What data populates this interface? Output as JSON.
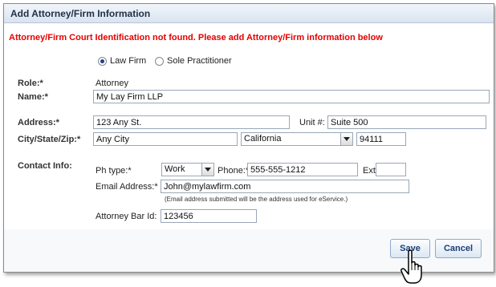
{
  "dialog": {
    "title": "Add Attorney/Firm Information"
  },
  "error_message": "Attorney/Firm Court Identification not found. Please add Attorney/Firm information below",
  "firm_type": {
    "options": [
      {
        "label": "Law Firm",
        "selected": true
      },
      {
        "label": "Sole Practitioner",
        "selected": false
      }
    ]
  },
  "role": {
    "label": "Role:*",
    "value": "Attorney"
  },
  "name": {
    "label": "Name:*",
    "value": "My Lay Firm LLP"
  },
  "address": {
    "label": "Address:*",
    "value": "123 Any St.",
    "unit_label": "Unit #:",
    "unit_value": "Suite 500"
  },
  "city_state_zip": {
    "label": "City/State/Zip:*",
    "city": "Any City",
    "state": "California",
    "zip": "94111"
  },
  "contact": {
    "label": "Contact Info:",
    "ph_type_label": "Ph type:*",
    "ph_type_value": "Work",
    "phone_label": "Phone:*",
    "phone_value": "555-555-1212",
    "ext_label": "Ext:",
    "ext_value": "",
    "email_label": "Email Address:*",
    "email_value": "John@mylawfirm.com",
    "email_note": "(Email address submitted will be the address used for eService.)",
    "bar_id_label": "Attorney Bar Id:",
    "bar_id_value": "123456"
  },
  "buttons": {
    "save": "Save",
    "cancel": "Cancel"
  },
  "icons": {
    "cursor": "hand-pointer-icon"
  }
}
